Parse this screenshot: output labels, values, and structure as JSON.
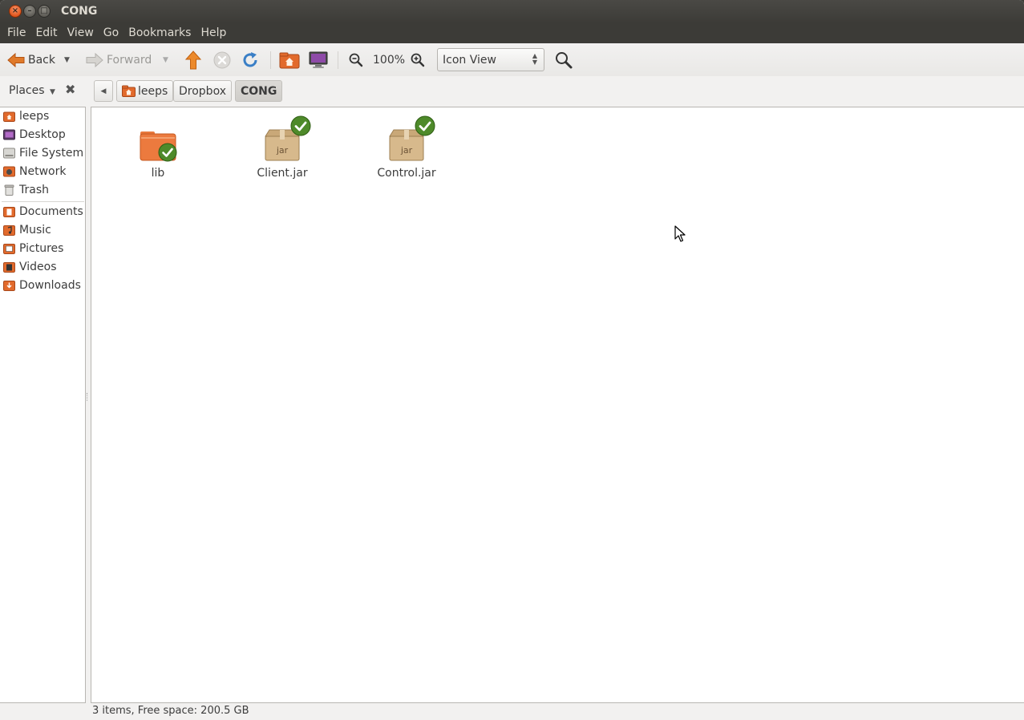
{
  "window": {
    "title": "CONG"
  },
  "menubar": [
    "File",
    "Edit",
    "View",
    "Go",
    "Bookmarks",
    "Help"
  ],
  "toolbar": {
    "back_label": "Back",
    "forward_label": "Forward",
    "zoom_level": "100%",
    "view_mode": "Icon View"
  },
  "locationbar": {
    "places_label": "Places",
    "breadcrumbs": [
      "leeps",
      "Dropbox",
      "CONG"
    ]
  },
  "sidebar": {
    "devices": [
      {
        "label": "leeps",
        "icon": "home-folder-icon"
      },
      {
        "label": "Desktop",
        "icon": "desktop-icon"
      },
      {
        "label": "File System",
        "icon": "harddisk-icon"
      },
      {
        "label": "Network",
        "icon": "network-icon"
      },
      {
        "label": "Trash",
        "icon": "trash-icon"
      }
    ],
    "bookmarks": [
      {
        "label": "Documents",
        "icon": "documents-folder-icon"
      },
      {
        "label": "Music",
        "icon": "music-folder-icon"
      },
      {
        "label": "Pictures",
        "icon": "pictures-folder-icon"
      },
      {
        "label": "Videos",
        "icon": "videos-folder-icon"
      },
      {
        "label": "Downloads",
        "icon": "downloads-folder-icon"
      }
    ]
  },
  "files": [
    {
      "name": "lib",
      "type": "folder",
      "synced": true
    },
    {
      "name": "Client.jar",
      "type": "jar",
      "badge_text": "jar",
      "synced": true
    },
    {
      "name": "Control.jar",
      "type": "jar",
      "badge_text": "jar",
      "synced": true
    }
  ],
  "status": {
    "text": "3 items, Free space: 200.5 GB"
  },
  "colors": {
    "accent": "#dd4814",
    "titlebar": "#3c3b37",
    "check": "#4b8b1c"
  }
}
